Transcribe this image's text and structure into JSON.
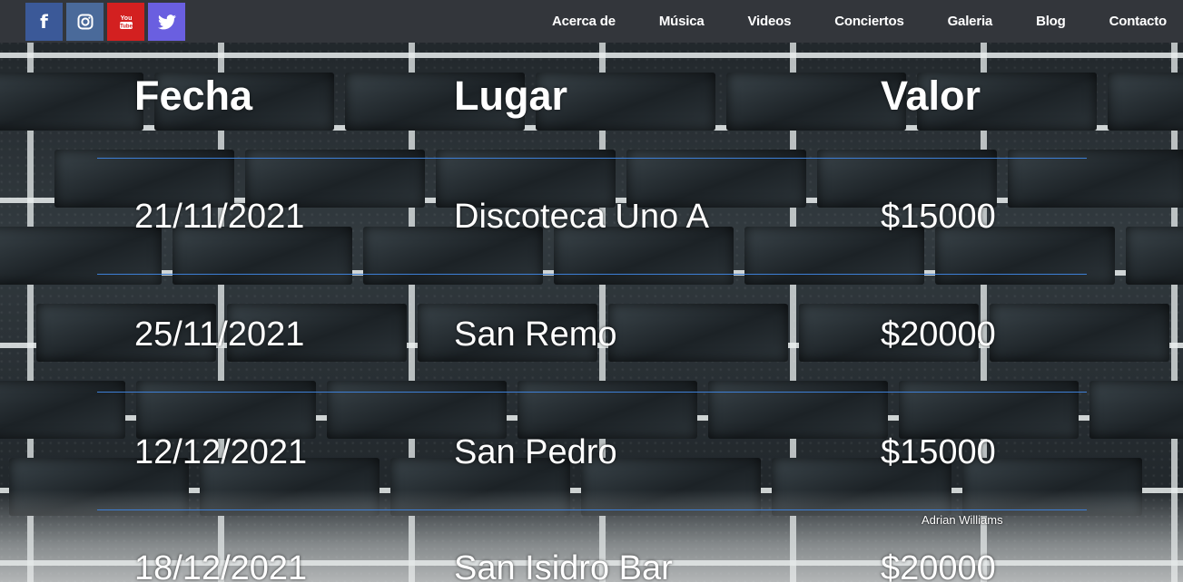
{
  "nav": {
    "social": [
      {
        "name": "facebook",
        "glyph": "f",
        "color": "#3b5998"
      },
      {
        "name": "instagram",
        "glyph": "",
        "color": "#4a6a9a"
      },
      {
        "name": "youtube",
        "glyph": "",
        "color": "#d32020"
      },
      {
        "name": "twitter",
        "glyph": "",
        "color": "#6a5fe0"
      }
    ],
    "links": [
      "Acerca de",
      "Música",
      "Videos",
      "Conciertos",
      "Galeria",
      "Blog",
      "Contacto"
    ]
  },
  "table": {
    "headers": [
      "Fecha",
      "Lugar",
      "Valor"
    ],
    "rows": [
      [
        "21/11/2021",
        "Discoteca Uno A",
        "$15000"
      ],
      [
        "25/11/2021",
        "San Remo",
        "$20000"
      ],
      [
        "12/12/2021",
        "San Pedro",
        "$15000"
      ],
      [
        "18/12/2021",
        "San Isidro Bar",
        "$20000"
      ]
    ],
    "rule_color": "#3d7fd6"
  },
  "watermark": "Adrian Williams"
}
